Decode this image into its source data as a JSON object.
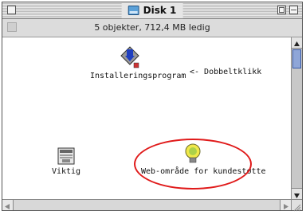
{
  "window": {
    "title": "Disk 1",
    "info": "5 objekter, 712,4 MB ledig"
  },
  "icons": {
    "installer": "Installeringsprogram",
    "important": "Viktig",
    "web": "Web-område for kundestøtte"
  },
  "note": "<- Dobbeltklikk",
  "colors": {
    "highlight": "#e01a1a",
    "scroll_thumb": "#8fa6d8"
  }
}
